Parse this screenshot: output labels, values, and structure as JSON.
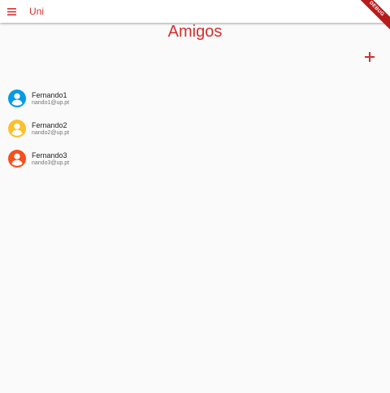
{
  "app_bar": {
    "title": "Uni",
    "menu_icon": "menu-icon",
    "debug_banner": "DEBUG",
    "accent": "#d32f2f"
  },
  "page": {
    "title": "Amigos",
    "add_icon": "plus-icon"
  },
  "friends": [
    {
      "name": "Fernando1",
      "email": "nando1@up.pt",
      "avatar_icon": "account-circle-icon",
      "avatar_color": "#039be5"
    },
    {
      "name": "Fernando2",
      "email": "nando2@up.pt",
      "avatar_icon": "account-circle-icon",
      "avatar_color": "#fbc02d"
    },
    {
      "name": "Fernando3",
      "email": "nando3@up.pt",
      "avatar_icon": "account-circle-icon",
      "avatar_color": "#f4511e"
    }
  ]
}
